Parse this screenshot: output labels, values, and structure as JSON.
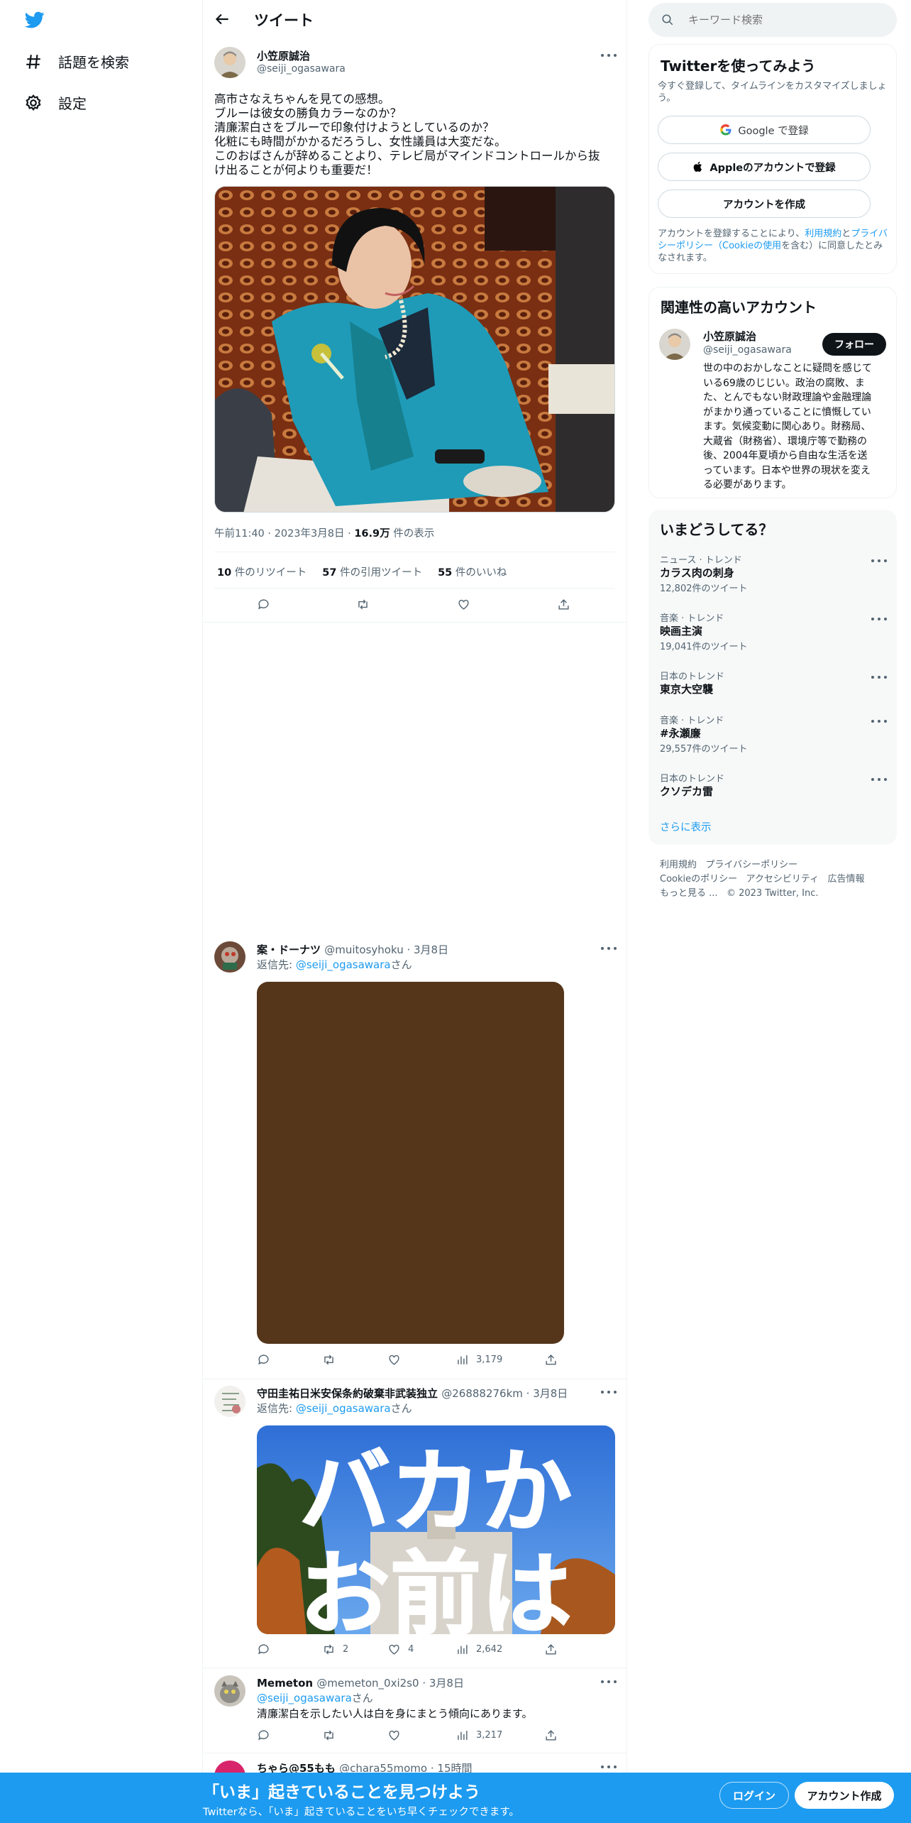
{
  "nav": {
    "explore": "話題を検索",
    "settings": "設定"
  },
  "header": {
    "title": "ツイート"
  },
  "main_tweet": {
    "name": "小笠原誠治",
    "handle": "@seiji_ogasawara",
    "lines": [
      "高市さなえちゃんを見ての感想。",
      "ブルーは彼女の勝負カラーなのか？",
      "清廉潔白さをブルーで印象付けようとしているのか？",
      "化粧にも時間がかかるだろうし、女性議員は大変だな。",
      "このおばさんが辞めることより、テレビ局がマインドコントロールから抜",
      "け出ることが何よりも重要だ！"
    ],
    "time": "午前11:40",
    "date": "2023年3月8日",
    "views_count": "16.9万",
    "views_label": "件の表示",
    "retweets_count": "10",
    "retweets_label": "件のリツイート",
    "quotes_count": "57",
    "quotes_label": "件の引用ツイート",
    "likes_count": "55",
    "likes_label": "件のいいね"
  },
  "replies": [
    {
      "name": "案・ドーナツ",
      "handle": "@muitosyhoku",
      "date": "3月8日",
      "reply_prefix": "返信先:",
      "reply_handle": "@seiji_ogasawara",
      "reply_suffix": "さん",
      "views": "3,179"
    },
    {
      "name": "守田圭祐日米安保条約破棄非武装独立",
      "handle": "@26888276km",
      "date": "3月8日",
      "reply_prefix": "返信先:",
      "reply_handle": "@seiji_ogasawara",
      "reply_suffix": "さん",
      "image_text_1": "バカか",
      "image_text_2": "お前は",
      "retweets": "2",
      "likes": "4",
      "views": "2,642"
    },
    {
      "name": "Memeton",
      "handle": "@memeton_0xi2s0",
      "date": "3月8日",
      "reply_prefix": "",
      "reply_handle": "@seiji_ogasawara",
      "reply_suffix": "さん",
      "text": "清廉潔白を示したい人は白を身にまとう傾向にあります。",
      "views": "3,217"
    },
    {
      "name": "ちゃら@55もも",
      "handle": "@chara55momo",
      "date": "15時間"
    }
  ],
  "search": {
    "placeholder": "キーワード検索"
  },
  "signup_card": {
    "title": "Twitterを使ってみよう",
    "subtitle": "今すぐ登録して、タイムラインをカスタマイズしましょう。",
    "google": "Google で登録",
    "apple": "Appleのアカウントで登録",
    "create": "アカウントを作成",
    "legal_1": "アカウントを登録することにより、",
    "terms": "利用規約",
    "and": "と",
    "privacy": "プライバシーポリシー",
    "cookie": "（Cookieの使用",
    "legal_2": "を含む）に同意したとみなされます。"
  },
  "related_card": {
    "title": "関連性の高いアカウント",
    "name": "小笠原誠治",
    "handle": "@seiji_ogasawara",
    "follow": "フォロー",
    "bio": [
      "世の中のおかしなことに疑問を感じて",
      "いる69歳のじじい。政治の腐敗、ま",
      "た、とんでもない財政理論や金融理論",
      "がまかり通っていることに憤慨してい",
      "ます。気候変動に関心あり。財務局、",
      "大蔵省（財務省）、環境庁等で勤務の",
      "後、2004年夏頃から自由な生活を送",
      "っています。日本や世界の現状を変え",
      "る必要があります。"
    ]
  },
  "trends_card": {
    "title": "いまどうしてる？",
    "items": [
      {
        "category": "ニュース · トレンド",
        "name": "カラス肉の刺身",
        "count": "12,802件のツイート"
      },
      {
        "category": "音楽 · トレンド",
        "name": "映画主演",
        "count": "19,041件のツイート"
      },
      {
        "category": "日本のトレンド",
        "name": "東京大空襲",
        "count": ""
      },
      {
        "category": "音楽 · トレンド",
        "name": "#永瀬廉",
        "count": "29,557件のツイート"
      },
      {
        "category": "日本のトレンド",
        "name": "クソデカ雷",
        "count": ""
      }
    ],
    "show_more": "さらに表示"
  },
  "footer": {
    "line1": [
      "利用規約",
      "プライバシーポリシー"
    ],
    "line2": [
      "Cookieのポリシー",
      "アクセシビリティ",
      "広告情報"
    ],
    "more": "もっと見る ...",
    "copyright": "© 2023 Twitter, Inc."
  },
  "bottom_bar": {
    "title": "「いま」起きていることを見つけよう",
    "subtitle": "Twitterなら、「いま」起きていることをいち早くチェックできます。",
    "login": "ログイン",
    "signup": "アカウント作成"
  },
  "colors": {
    "accent": "#1d9bf0",
    "text": "#0f1419",
    "muted": "#536471",
    "border": "#eff3f4"
  }
}
